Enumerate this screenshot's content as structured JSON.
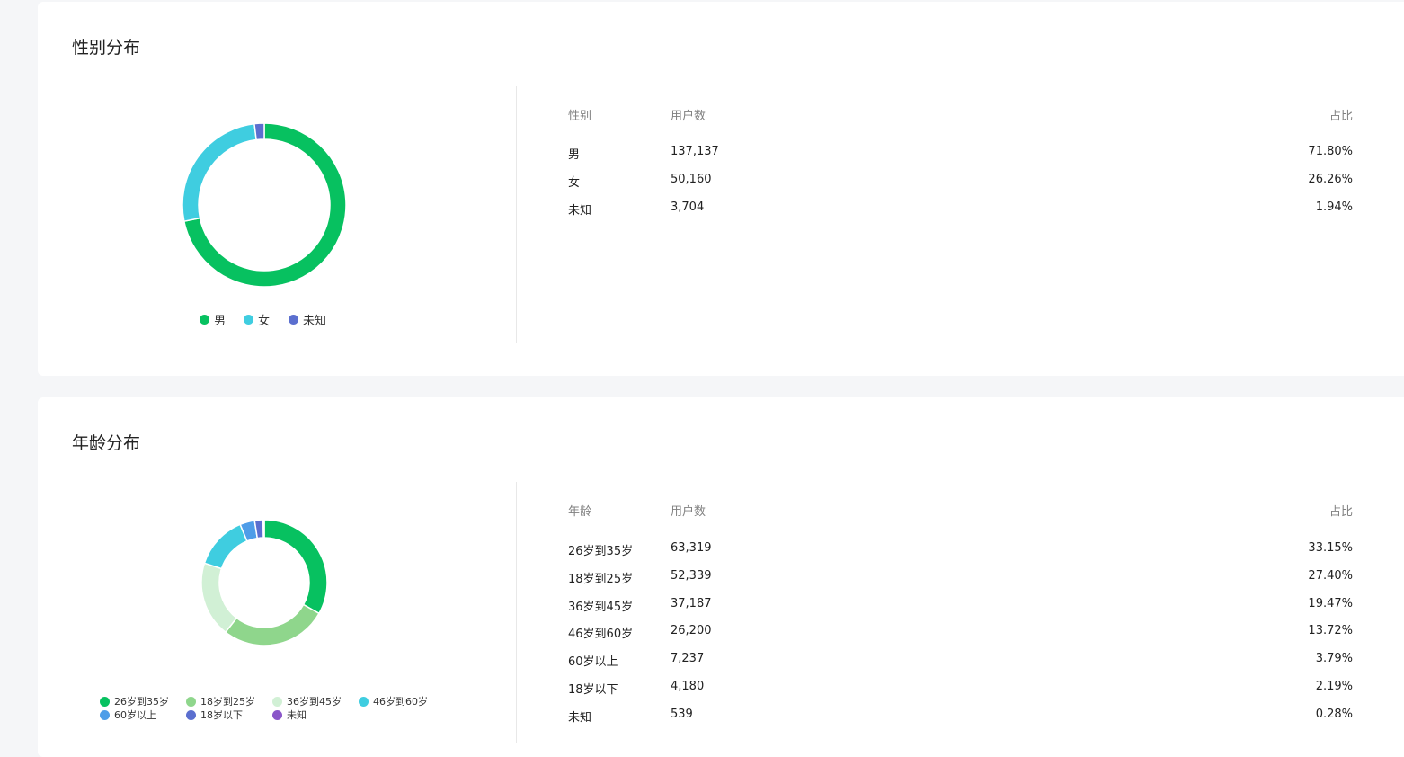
{
  "gender": {
    "title": "性别分布",
    "table": {
      "headers": [
        "性别",
        "用户数",
        "占比"
      ],
      "rows": [
        {
          "label": "男",
          "users": "137,137",
          "pct": "71.80%"
        },
        {
          "label": "女",
          "users": "50,160",
          "pct": "26.26%"
        },
        {
          "label": "未知",
          "users": "3,704",
          "pct": "1.94%"
        }
      ]
    },
    "legend": [
      "男",
      "女",
      "未知"
    ],
    "colors": [
      "#07c160",
      "#3fcde0",
      "#5b6fcf"
    ],
    "chart_data": {
      "type": "pie",
      "categories": [
        "男",
        "女",
        "未知"
      ],
      "values": [
        71.8,
        26.26,
        1.94
      ]
    }
  },
  "age": {
    "title": "年龄分布",
    "table": {
      "headers": [
        "年龄",
        "用户数",
        "占比"
      ],
      "rows": [
        {
          "label": "26岁到35岁",
          "users": "63,319",
          "pct": "33.15%"
        },
        {
          "label": "18岁到25岁",
          "users": "52,339",
          "pct": "27.40%"
        },
        {
          "label": "36岁到45岁",
          "users": "37,187",
          "pct": "19.47%"
        },
        {
          "label": "46岁到60岁",
          "users": "26,200",
          "pct": "13.72%"
        },
        {
          "label": "60岁以上",
          "users": "7,237",
          "pct": "3.79%"
        },
        {
          "label": "18岁以下",
          "users": "4,180",
          "pct": "2.19%"
        },
        {
          "label": "未知",
          "users": "539",
          "pct": "0.28%"
        }
      ]
    },
    "legend": [
      "26岁到35岁",
      "18岁到25岁",
      "36岁到45岁",
      "46岁到60岁",
      "60岁以上",
      "18岁以下",
      "未知"
    ],
    "colors": [
      "#07c160",
      "#8fd68c",
      "#d1f0d5",
      "#3fcde0",
      "#4e9de8",
      "#5b6fcf",
      "#8a56c9"
    ],
    "chart_data": {
      "type": "pie",
      "categories": [
        "26岁到35岁",
        "18岁到25岁",
        "36岁到45岁",
        "46岁到60岁",
        "60岁以上",
        "18岁以下",
        "未知"
      ],
      "values": [
        33.15,
        27.4,
        19.47,
        13.72,
        3.79,
        2.19,
        0.28
      ]
    }
  }
}
